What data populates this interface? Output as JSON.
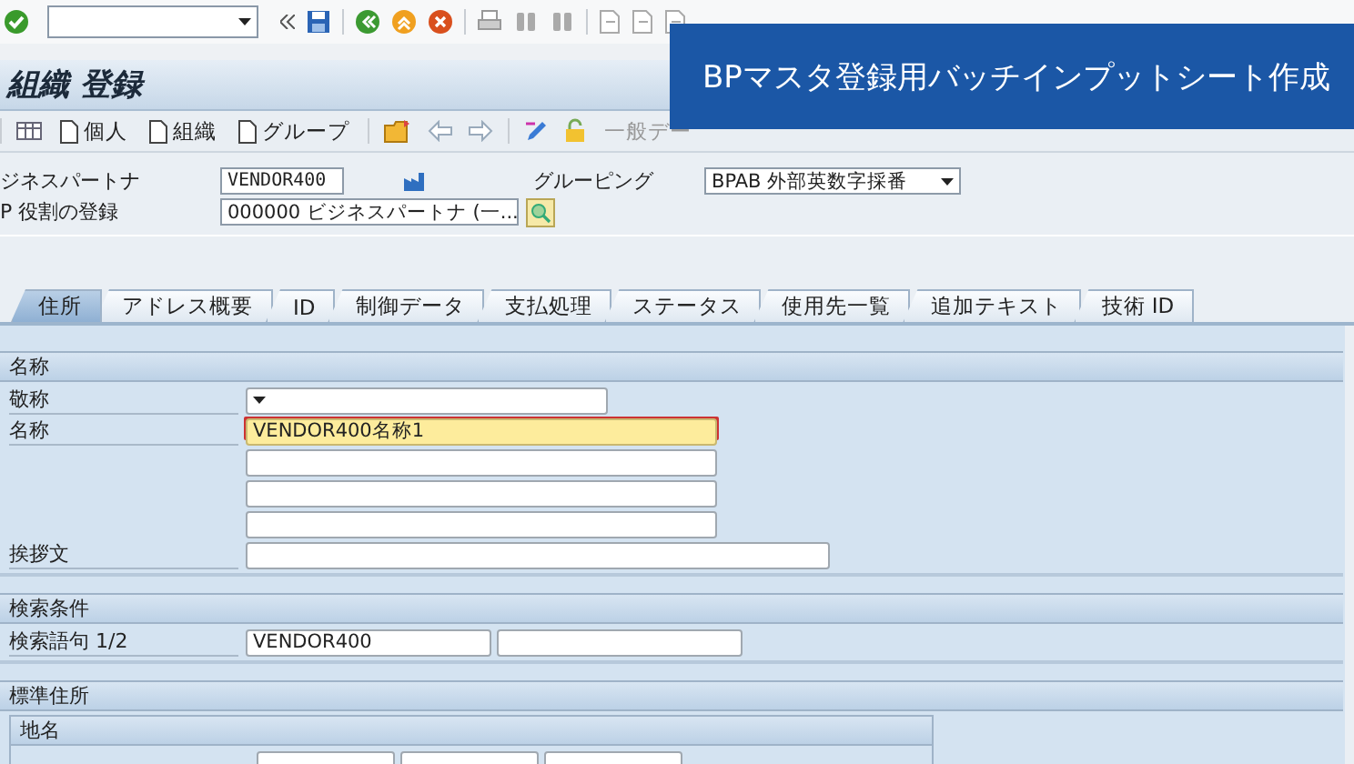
{
  "system_toolbar": {
    "command_field": {
      "kind": "dropdown"
    }
  },
  "title": "組織 登録",
  "app_toolbar": [
    {
      "kind": "table"
    },
    {
      "kind": "doc",
      "label": "個人"
    },
    {
      "kind": "doc",
      "label": "組織"
    },
    {
      "kind": "doc",
      "label": "グループ"
    },
    {
      "kind": "folder"
    },
    {
      "kind": "left"
    },
    {
      "kind": "right"
    },
    {
      "kind": "pencil"
    },
    {
      "kind": "lock"
    },
    {
      "kind": "text",
      "label": "一般デー"
    }
  ],
  "header_fields": [
    {
      "label": "ジネスパートナ",
      "value": "VENDOR400",
      "kind": "text"
    },
    {
      "label": "P 役割の登録",
      "value": "000000 ビジネスパートナ (一...",
      "kind": "dropdown"
    }
  ],
  "grouping": {
    "label": "グルーピング",
    "value": "BPAB 外部英数字採番"
  },
  "banner": "BPマスタ登録用バッチインプットシート作成",
  "tabs": [
    {
      "label": "住所",
      "selected": true
    },
    {
      "label": "アドレス概要",
      "selected": false
    },
    {
      "label": "ID",
      "selected": false
    },
    {
      "label": "制御データ",
      "selected": false
    },
    {
      "label": "支払処理",
      "selected": false
    },
    {
      "label": "ステータス",
      "selected": false
    },
    {
      "label": "使用先一覧",
      "selected": false
    },
    {
      "label": "追加テキスト",
      "selected": false
    },
    {
      "label": "技術 ID",
      "selected": false
    }
  ],
  "sections": [
    {
      "title": "名称",
      "rows": [
        {
          "label": "敬称",
          "fields": [
            {
              "kind": "dropdown",
              "focused": false
            }
          ]
        },
        {
          "label": "名称",
          "fields": [
            {
              "kind": "name",
              "value": "VENDOR400名称1",
              "focused": true
            }
          ]
        },
        {
          "fields": [
            {
              "kind": "name",
              "focused": false
            }
          ]
        },
        {
          "fields": [
            {
              "kind": "name",
              "focused": false
            }
          ]
        },
        {
          "fields": [
            {
              "kind": "name",
              "focused": false
            }
          ]
        },
        {
          "label": "挨拶文",
          "fields": [
            {
              "kind": "wide",
              "focused": false
            }
          ]
        }
      ]
    },
    {
      "title": "検索条件",
      "rows": [
        {
          "label": "検索語句 1/2",
          "fields": [
            {
              "kind": "short",
              "value": "VENDOR400",
              "focused": false
            },
            {
              "kind": "short",
              "focused": false
            }
          ]
        }
      ]
    },
    {
      "title": "標準住所",
      "group": "地名",
      "rows": [
        {
          "fields": [
            {
              "kind": "tiny"
            },
            {
              "kind": "tiny"
            },
            {
              "kind": "tiny"
            }
          ]
        }
      ]
    }
  ]
}
